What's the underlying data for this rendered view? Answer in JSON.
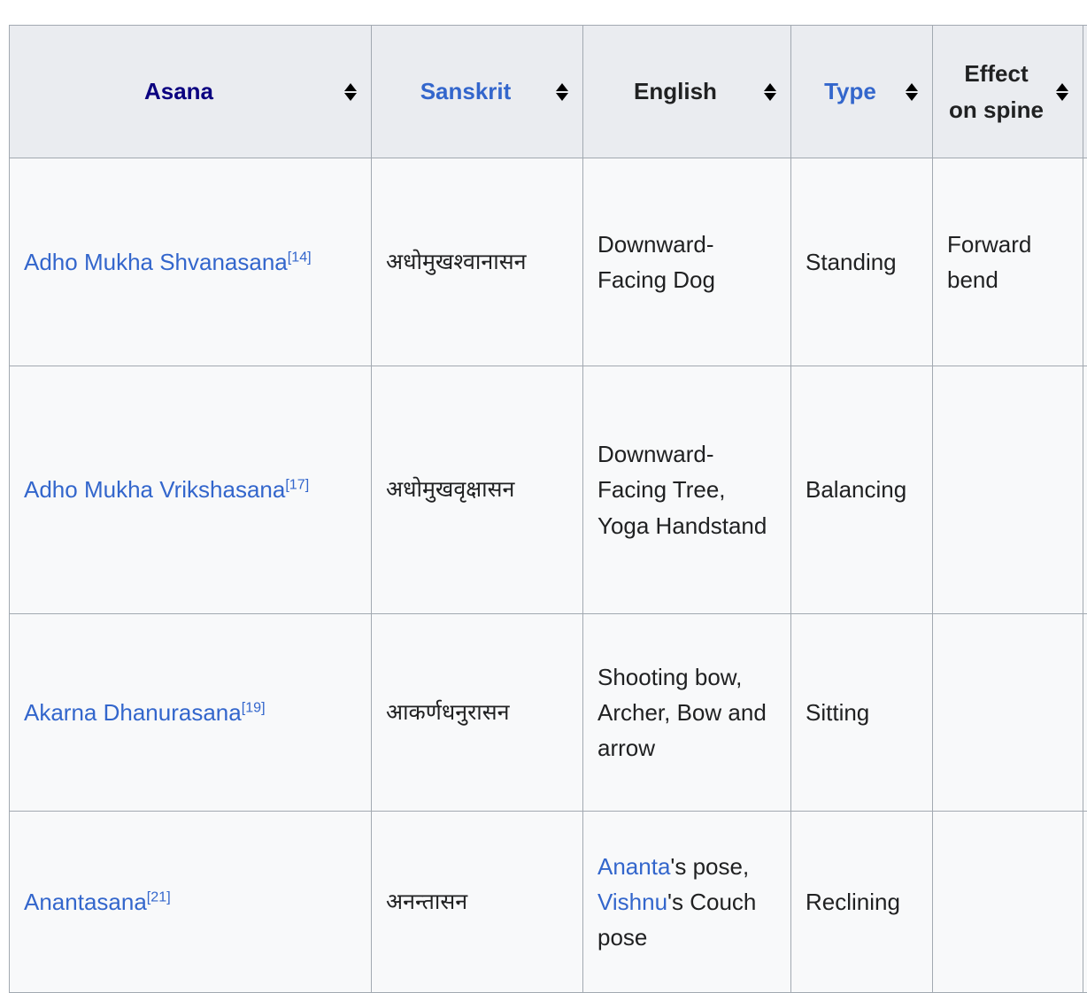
{
  "table": {
    "columns": [
      {
        "key": "asana",
        "label": "Asana",
        "link": true,
        "visited": true,
        "sortable": true
      },
      {
        "key": "sanskrit",
        "label": "Sanskrit",
        "link": true,
        "visited": false,
        "sortable": true
      },
      {
        "key": "english",
        "label": "English",
        "link": false,
        "visited": false,
        "sortable": true
      },
      {
        "key": "type",
        "label": "Type",
        "link": true,
        "visited": false,
        "sortable": true
      },
      {
        "key": "effect",
        "label": "Effect on spine",
        "link": false,
        "visited": false,
        "sortable": true
      }
    ],
    "sort_icon_name": "sort-both-icon",
    "rows": [
      {
        "asana_name": "Adho Mukha Shvanasana",
        "asana_ref": "[14]",
        "sanskrit": "अधोमुखश्वानासन",
        "english": "Downward-Facing Dog",
        "type": "Standing",
        "effect": "Forward bend"
      },
      {
        "asana_name": "Adho Mukha Vrikshasana",
        "asana_ref": "[17]",
        "sanskrit": "अधोमुखवृक्षासन",
        "english": "Downward-Facing Tree, Yoga Handstand",
        "type": "Balancing",
        "effect": ""
      },
      {
        "asana_name": "Akarna Dhanurasana",
        "asana_ref": "[19]",
        "sanskrit": "आकर्णधनुरासन",
        "english": "Shooting bow, Archer, Bow and arrow",
        "type": "Sitting",
        "effect": ""
      },
      {
        "asana_name": "Anantasana",
        "asana_ref": "[21]",
        "sanskrit": "अनन्तासन",
        "english_parts": [
          {
            "text": "Ananta",
            "link": true
          },
          {
            "text": "'s pose, ",
            "link": false
          },
          {
            "text": "Vishnu",
            "link": true
          },
          {
            "text": "'s Couch pose",
            "link": false
          }
        ],
        "english": "Ananta's pose, Vishnu's Couch pose",
        "type": "Reclining",
        "effect": ""
      }
    ]
  },
  "colors": {
    "link": "#3366cc",
    "visited_link": "#0b0080",
    "header_bg": "#eaecf0",
    "cell_bg": "#f8f9fa",
    "border": "#a2a9b1",
    "text": "#202122"
  }
}
